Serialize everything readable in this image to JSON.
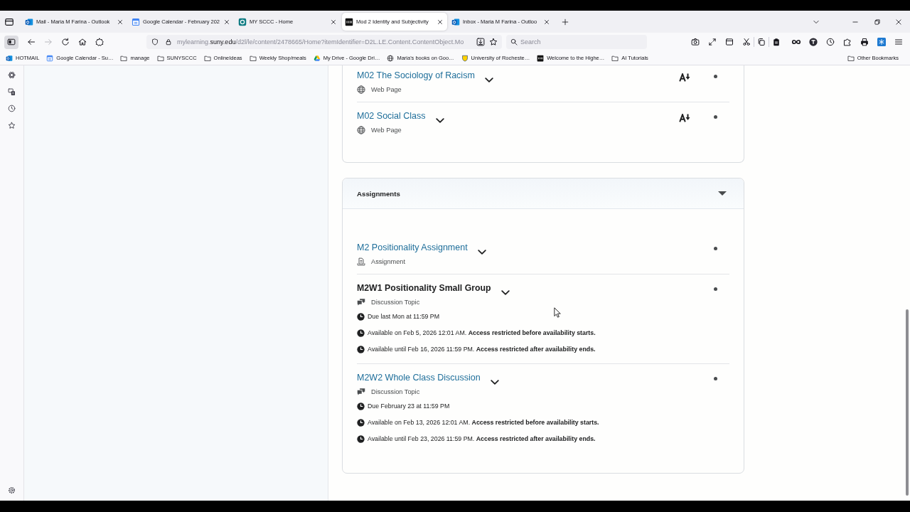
{
  "browser": {
    "tabs": [
      {
        "title": "Mail - Maria M Farina - Outlook",
        "kind": "outlook",
        "selected": false
      },
      {
        "title": "Google Calendar - February 202",
        "kind": "calendar",
        "selected": false
      },
      {
        "title": "MY SCCC - Home",
        "kind": "sccc",
        "selected": false
      },
      {
        "title": "Mod 2 Identity and Subjectivity",
        "kind": "d2l",
        "selected": true
      },
      {
        "title": "Inbox - Maria M Farina - Outloo",
        "kind": "outlook",
        "selected": false
      }
    ],
    "sidebar_toggle": {
      "selected": true
    },
    "nav_buttons": [
      {
        "kind": "back",
        "disabled": false
      },
      {
        "kind": "forward",
        "disabled": true
      },
      {
        "kind": "reload",
        "disabled": false
      },
      {
        "kind": "home",
        "disabled": false
      }
    ],
    "address": {
      "subdomain": "mylearning.",
      "domain": "suny.edu",
      "path": "/d2l/le/content/2478665/Home?itemIdentifier=D2L.LE.Content.ContentObject.Mo"
    },
    "search": {
      "placeholder": "Search"
    },
    "bookmarks": [
      {
        "label": "HOTMAIL",
        "kind": "outlook"
      },
      {
        "label": "Google Calendar - Su…",
        "kind": "calendar"
      },
      {
        "label": "manage",
        "kind": "folder"
      },
      {
        "label": "SUNYSCCC",
        "kind": "folder"
      },
      {
        "label": "OnlineIdeas",
        "kind": "folder"
      },
      {
        "label": "Weekly Shop/meals",
        "kind": "folder"
      },
      {
        "label": "My Drive - Google Dri…",
        "kind": "drive"
      },
      {
        "label": "Maria's books on Goo…",
        "kind": "globe"
      },
      {
        "label": "University of Rocheste…",
        "kind": "shield"
      },
      {
        "label": "Welcome to the Highe…",
        "kind": "d2l"
      },
      {
        "label": "AI Tutorials",
        "kind": "folder"
      }
    ],
    "other_bookmarks": {
      "label": "Other Bookmarks",
      "kind": "folder"
    }
  },
  "content": {
    "modules": [
      {
        "items": [
          {
            "title": "M02 The Sociology of Racism",
            "link": true,
            "kind": "webpage",
            "type_label": "Web Page"
          },
          {
            "title": "M02 Social Class",
            "link": true,
            "kind": "webpage",
            "type_label": "Web Page"
          }
        ]
      },
      {
        "title": "Assignments",
        "expanded": true,
        "items": [
          {
            "title": "M2 Positionality Assignment",
            "link": true,
            "kind": "assignment",
            "type_label": "Assignment"
          },
          {
            "title": "M2W1 Positionality Small Group",
            "link": false,
            "kind": "discussion",
            "type_label": "Discussion Topic",
            "details": [
              "Due last Mon at 11:59 PM",
              "Available on Feb 5, 2026 12:01 AM. **Access restricted before availability starts.**",
              "Available until Feb 16, 2026 11:59 PM. **Access restricted after availability ends.**"
            ]
          },
          {
            "title": "M2W2 Whole Class Discussion",
            "link": true,
            "kind": "discussion",
            "type_label": "Discussion Topic",
            "details": [
              "Due February 23 at 11:59 PM",
              "Available on Feb 13, 2026 12:01 AM. **Access restricted before availability starts.**",
              "Available until Feb 23, 2026 11:59 PM. **Access restricted after availability ends.**"
            ]
          }
        ]
      }
    ]
  }
}
